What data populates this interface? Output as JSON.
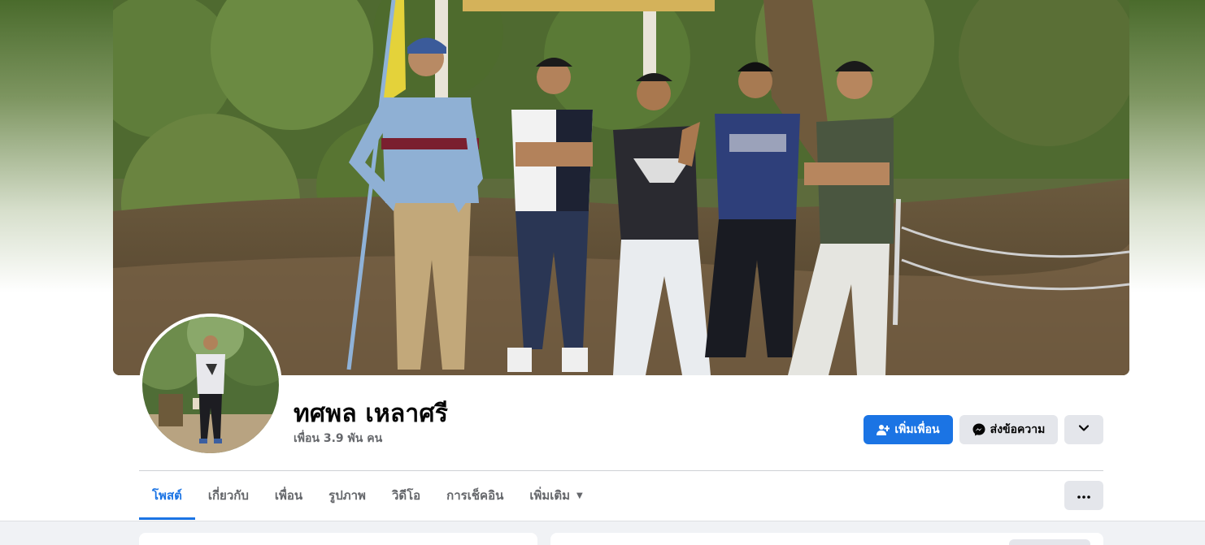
{
  "profile": {
    "name": "ทศพล เหลาศรี",
    "friends": "เพื่อน 3.9 พัน คน"
  },
  "actions": {
    "add_friend": "เพิ่มเพื่อน",
    "message": "ส่งข้อความ"
  },
  "tabs": [
    {
      "label": "โพสต์",
      "active": true
    },
    {
      "label": "เกี่ยวกับ"
    },
    {
      "label": "เพื่อน"
    },
    {
      "label": "รูปภาพ"
    },
    {
      "label": "วิดีโอ"
    },
    {
      "label": "การเช็คอิน"
    },
    {
      "label": "เพิ่มเติม"
    }
  ],
  "icons": {
    "add_friend": "person-plus-icon",
    "message": "messenger-icon",
    "dropdown": "chevron-down-icon",
    "more": "more-dots-icon",
    "tab_more": "caret-down-icon"
  },
  "colors": {
    "accent": "#1b74e4",
    "secondary_button": "#e4e6eb",
    "muted_text": "#65676b"
  }
}
